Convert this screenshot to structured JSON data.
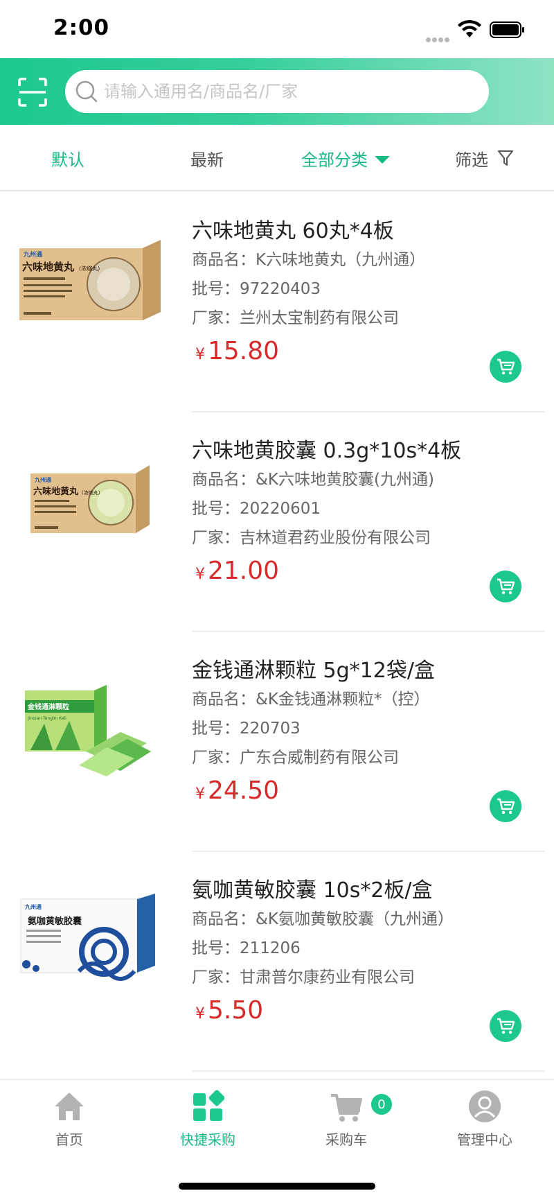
{
  "status_bar": {
    "time": "2:00"
  },
  "search": {
    "placeholder": "请输入通用名/商品名/厂家"
  },
  "filters": {
    "default_label": "默认",
    "latest_label": "最新",
    "category_label": "全部分类",
    "filter_label": "筛选"
  },
  "products": [
    {
      "name": "六味地黄丸 60丸*4板",
      "trade_name": "商品名：K六味地黄丸（九州通）",
      "batch": "批号：97220403",
      "maker": "厂家：兰州太宝制药有限公司",
      "currency": "¥",
      "price": "15.80",
      "box_title": "六味地黄丸",
      "box_sub": "(浓缩丸)"
    },
    {
      "name": "六味地黄胶囊 0.3g*10s*4板",
      "trade_name": "商品名：&K六味地黄胶囊(九州通)",
      "batch": "批号：20220601",
      "maker": "厂家：吉林道君药业股份有限公司",
      "currency": "¥",
      "price": "21.00",
      "box_title": "六味地黄丸",
      "box_sub": "(浓缩丸)"
    },
    {
      "name": "金钱通淋颗粒 5g*12袋/盒",
      "trade_name": "商品名：&K金钱通淋颗粒*（控）",
      "batch": "批号：220703",
      "maker": "厂家：广东合威制药有限公司",
      "currency": "¥",
      "price": "24.50",
      "box_title": "金钱通淋颗粒",
      "box_sub": "Jinqian Tonglin Keli"
    },
    {
      "name": "氨咖黄敏胶囊 10s*2板/盒",
      "trade_name": "商品名：&K氨咖黄敏胶囊（九州通）",
      "batch": "批号：211206",
      "maker": "厂家：甘肃普尔康药业有限公司",
      "currency": "¥",
      "price": "5.50",
      "box_title": "氨咖黄敏胶囊",
      "box_sub": ""
    }
  ],
  "tabbar": {
    "home_label": "首页",
    "quick_label": "快捷采购",
    "cart_label": "采购车",
    "cart_count": "0",
    "admin_label": "管理中心"
  },
  "colors": {
    "brand": "#1dc790",
    "price": "#d72a2a",
    "active_text": "#19b985"
  }
}
